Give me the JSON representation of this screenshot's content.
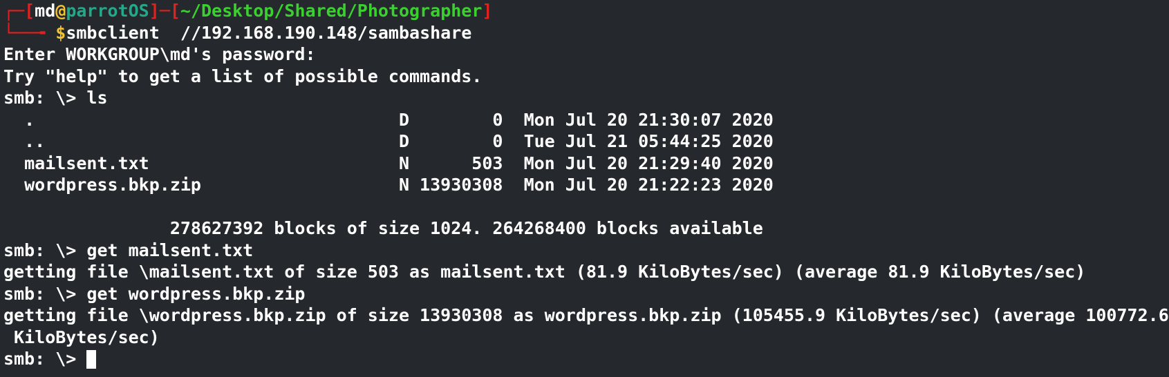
{
  "prompt": {
    "box_top": "┌─[",
    "user": "md",
    "at": "@",
    "host": "parrotOS",
    "sep": "]─[",
    "path": "~/Desktop/Shared/Photographer",
    "close": "]",
    "box_bottom": "└──╼ ",
    "dollar": "$",
    "command": "smbclient  //192.168.190.148/sambashare"
  },
  "lines": [
    "Enter WORKGROUP\\md's password:",
    "Try \"help\" to get a list of possible commands.",
    "smb: \\> ls",
    "  .                                   D        0  Mon Jul 20 21:30:07 2020",
    "  ..                                  D        0  Tue Jul 21 05:44:25 2020",
    "  mailsent.txt                        N      503  Mon Jul 20 21:29:40 2020",
    "  wordpress.bkp.zip                   N 13930308  Mon Jul 20 21:22:23 2020",
    "",
    "                278627392 blocks of size 1024. 264268400 blocks available",
    "smb: \\> get mailsent.txt",
    "getting file \\mailsent.txt of size 503 as mailsent.txt (81.9 KiloBytes/sec) (average 81.9 KiloBytes/sec)",
    "smb: \\> get wordpress.bkp.zip",
    "getting file \\wordpress.bkp.zip of size 13930308 as wordpress.bkp.zip (105455.9 KiloBytes/sec) (average 100772.6",
    " KiloBytes/sec)"
  ],
  "final_prompt": "smb: \\> "
}
